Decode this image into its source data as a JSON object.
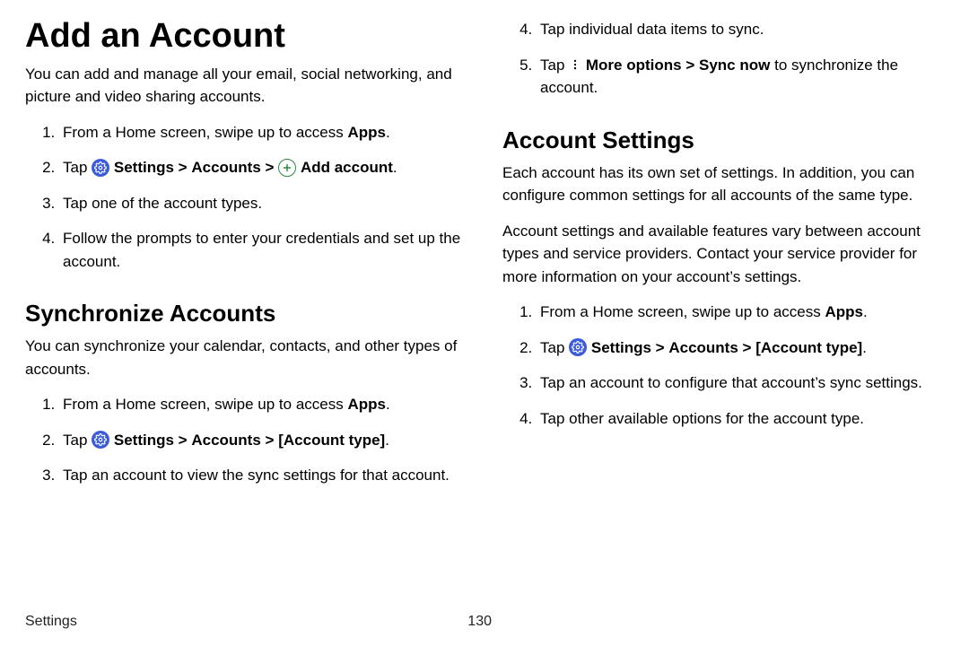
{
  "left": {
    "h1": "Add an Account",
    "intro": "You can add and manage all your email, social networking, and picture and video sharing accounts.",
    "steps1": {
      "s1_a": "From a Home screen, swipe up to access ",
      "s1_b": "Apps",
      "s1_c": ".",
      "s2_a": "Tap ",
      "s2_b": " Settings",
      "s2_c": "Accounts",
      "s2_d": " Add account",
      "s2_e": ".",
      "s3": "Tap one of the account types.",
      "s4": "Follow the prompts to enter your credentials and set up the account."
    },
    "h2": "Synchronize Accounts",
    "intro2": "You can synchronize your calendar, contacts, and other types of accounts.",
    "steps2": {
      "s1_a": "From a Home screen, swipe up to access ",
      "s1_b": "Apps",
      "s1_c": ".",
      "s2_a": "Tap ",
      "s2_b": " Settings",
      "s2_c": "Accounts",
      "s2_d": "[Account type]",
      "s2_e": ".",
      "s3": "Tap an account to view the sync settings for that account."
    }
  },
  "right": {
    "cont": {
      "s4": "Tap individual data items to sync.",
      "s5_a": "Tap ",
      "s5_b": " More options",
      "s5_c": "Sync now",
      "s5_d": " to synchronize the account."
    },
    "h2": "Account Settings",
    "p1": "Each account has its own set of settings. In addition, you can configure common settings for all accounts of the same type.",
    "p2": "Account settings and available features vary between account types and service providers. Contact your service provider for more information on your account’s settings.",
    "steps3": {
      "s1_a": "From a Home screen, swipe up to access ",
      "s1_b": "Apps",
      "s1_c": ".",
      "s2_a": "Tap ",
      "s2_b": " Settings",
      "s2_c": "Accounts",
      "s2_d": "[Account type]",
      "s2_e": ".",
      "s3": "Tap an account to configure that account’s sync settings.",
      "s4": "Tap other available options for the account type."
    }
  },
  "footer": {
    "section": "Settings",
    "page": "130"
  },
  "glyph": {
    "chev": ">"
  }
}
